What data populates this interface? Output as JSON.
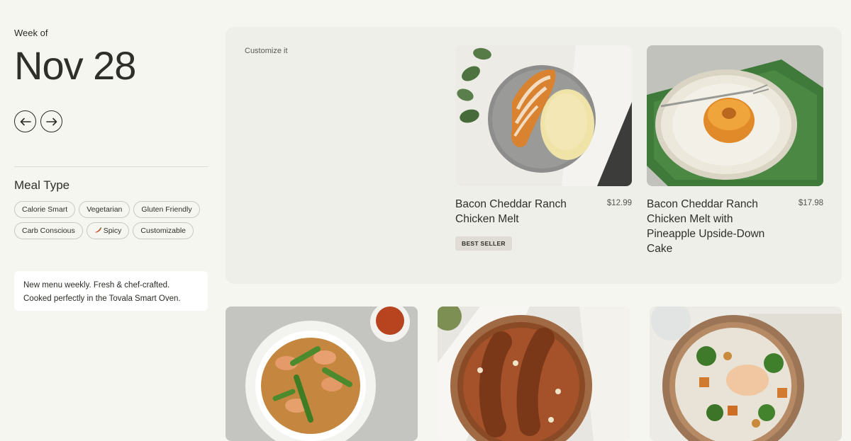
{
  "sidebar": {
    "week_of": "Week of",
    "date": "Nov 28",
    "meal_type_heading": "Meal Type",
    "filters_row1": [
      "Calorie Smart",
      "Vegetarian",
      "Gluten Friendly"
    ],
    "filters_row2": [
      "Carb Conscious",
      "Spicy",
      "Customizable"
    ],
    "spicy_icon": "chili-pepper-icon",
    "info_text": "New menu weekly. Fresh & chef-crafted. Cooked perfectly in the Tovala Smart Oven."
  },
  "feature": {
    "label": "Customize it",
    "meals": [
      {
        "name": "Bacon Cheddar Ranch Chicken Melt",
        "price": "$12.99",
        "badge": "BEST SELLER"
      },
      {
        "name": "Bacon Cheddar Ranch Chicken Melt with Pineapple Upside-Down Cake",
        "price": "$17.98"
      }
    ]
  },
  "bottom_meals": [
    {
      "image": "shrimp-noodle-bowl-photo"
    },
    {
      "image": "sausage-bean-stew-photo"
    },
    {
      "image": "chickpea-veggie-bowl-photo"
    }
  ],
  "colors": {
    "background": "#f6f6f1",
    "feature_panel": "#efefea",
    "badge": "#dedcd5",
    "text": "#2b2b27"
  }
}
